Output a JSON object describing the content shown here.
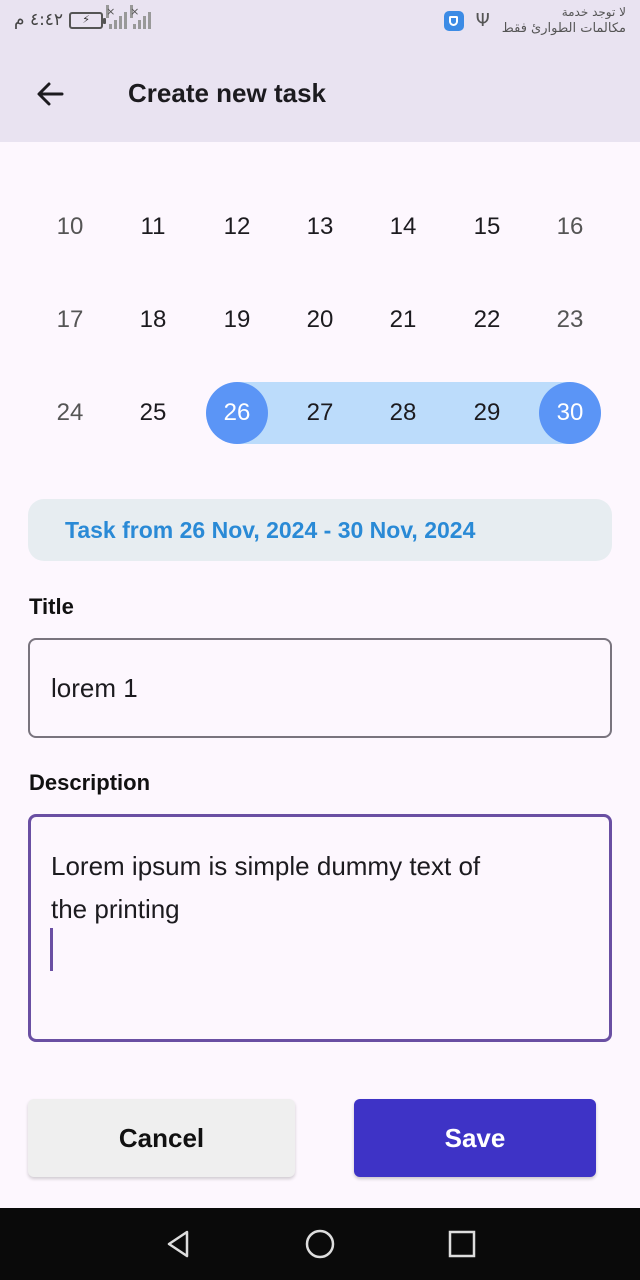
{
  "status_bar": {
    "time": "٤:٤٢ م",
    "carrier_line1": "لا توجد خدمة",
    "carrier_line2": "مكالمات الطوارئ فقط",
    "icons": [
      "battery-charging-icon",
      "signal-no-service-icon",
      "signal-no-service-icon",
      "usb-icon",
      "vpn-shield-icon"
    ]
  },
  "app_bar": {
    "back_icon": "arrow-left-icon",
    "title": "Create new task"
  },
  "calendar": {
    "weeks": [
      [
        "10",
        "11",
        "12",
        "13",
        "14",
        "15",
        "16"
      ],
      [
        "17",
        "18",
        "19",
        "20",
        "21",
        "22",
        "23"
      ],
      [
        "24",
        "25",
        "26",
        "27",
        "28",
        "29",
        "30"
      ]
    ],
    "range_start": "26",
    "range_end": "30",
    "selected_color": "#5b95f6",
    "range_color": "#bcdcfb"
  },
  "range_summary": "Task from 26 Nov, 2024 - 30 Nov, 2024",
  "form": {
    "title_label": "Title",
    "title_value": "lorem 1",
    "description_label": "Description",
    "description_line1": "Lorem ipsum is simple dummy text of",
    "description_line2": "the printing"
  },
  "buttons": {
    "cancel": "Cancel",
    "save": "Save",
    "save_color": "#3e33c6"
  },
  "nav_bar": {
    "icons": [
      "back-triangle-icon",
      "home-circle-icon",
      "recents-square-icon"
    ]
  }
}
